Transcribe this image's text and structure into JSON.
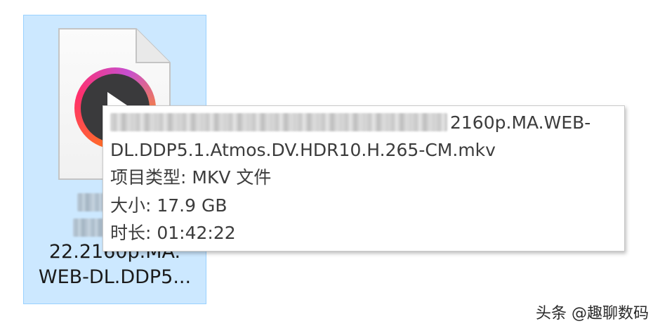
{
  "file": {
    "name_line_3": "22.2160p.MA.",
    "name_line_4": "WEB-DL.DDP5..."
  },
  "tooltip": {
    "name_visible": "2160p.MA.WEB-",
    "name_line_2": "DL.DDP5.1.Atmos.DV.HDR10.H.265-CM.mkv",
    "type_label": "项目类型: MKV 文件",
    "size_label": "大小: 17.9 GB",
    "duration_label": "时长: 01:42:22"
  },
  "watermark": {
    "text": "头条 @趣聊数码"
  },
  "colors": {
    "selection_bg": "#cce8ff",
    "selection_border": "#99d1ff",
    "tooltip_text": "#3c3c3c"
  },
  "icons": {
    "file": "document-icon",
    "media": "play-badge-icon"
  }
}
